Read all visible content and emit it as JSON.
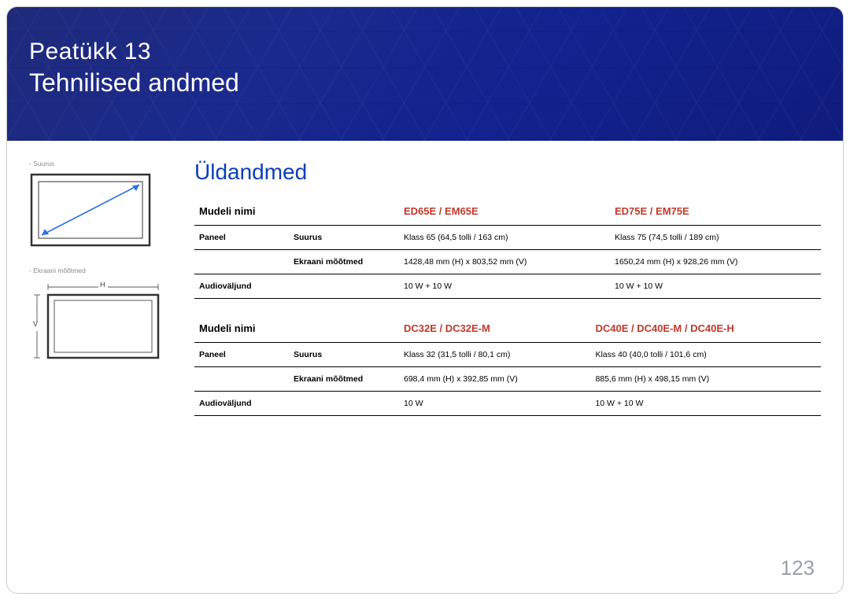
{
  "header": {
    "chapter": "Peatükk  13",
    "title": "Tehnilised andmed"
  },
  "sidebar": {
    "caption1": "-  Suurus",
    "caption2": "-  Ekraani mõõtmed",
    "dim_h": "H",
    "dim_v": "V"
  },
  "section_title": "Üldandmed",
  "table1": {
    "head": {
      "c1": "Mudeli nimi",
      "c2": "",
      "c3": "ED65E / EM65E",
      "c4": "ED75E / EM75E"
    },
    "rows": [
      {
        "c1": "Paneel",
        "c2": "Suurus",
        "c3": "Klass 65 (64,5 tolli / 163 cm)",
        "c4": "Klass 75 (74,5 tolli / 189 cm)"
      },
      {
        "c1": "",
        "c2": "Ekraani mõõtmed",
        "c3": "1428,48 mm (H) x 803,52 mm (V)",
        "c4": "1650,24 mm (H) x 928,26 mm (V)"
      },
      {
        "c1": "Audioväljund",
        "c2": "",
        "c3": "10 W + 10 W",
        "c4": "10 W + 10 W"
      }
    ]
  },
  "table2": {
    "head": {
      "c1": "Mudeli nimi",
      "c2": "",
      "c3": "DC32E / DC32E-M",
      "c4": "DC40E / DC40E-M / DC40E-H"
    },
    "rows": [
      {
        "c1": "Paneel",
        "c2": "Suurus",
        "c3": "Klass 32 (31,5 tolli / 80,1 cm)",
        "c4": "Klass 40 (40,0 tolli / 101,6 cm)"
      },
      {
        "c1": "",
        "c2": "Ekraani mõõtmed",
        "c3": "698,4 mm (H) x 392,85 mm (V)",
        "c4": "885,6 mm (H) x 498,15 mm (V)"
      },
      {
        "c1": "Audioväljund",
        "c2": "",
        "c3": "10 W",
        "c4": "10 W + 10 W"
      }
    ]
  },
  "page_number": "123"
}
